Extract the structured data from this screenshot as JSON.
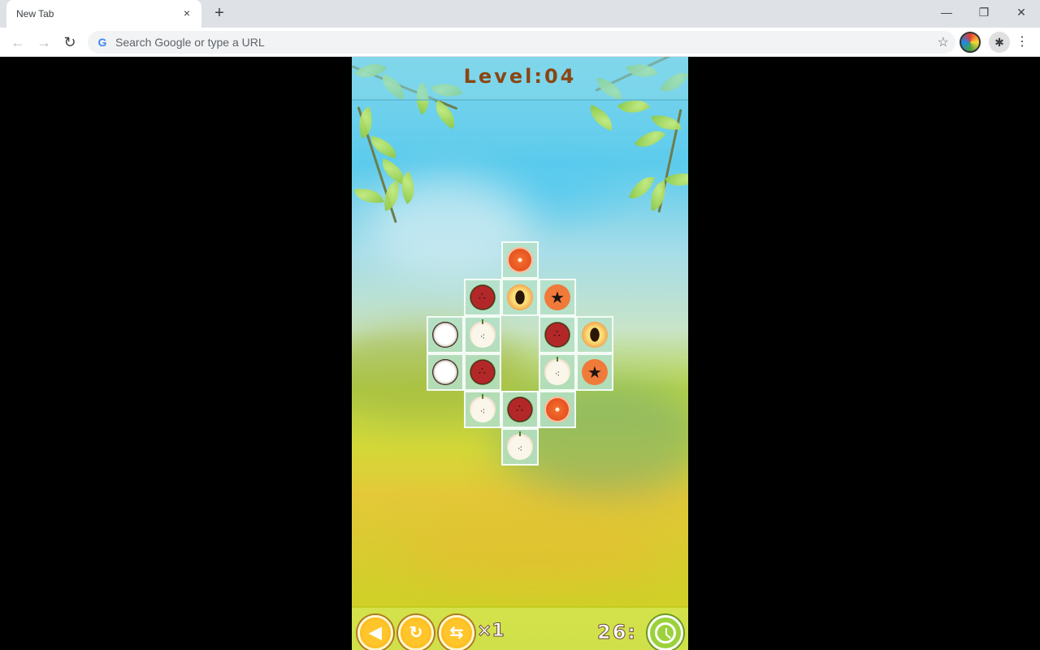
{
  "browser": {
    "tab_title": "New Tab",
    "tab_close_icon": "×",
    "new_tab_icon": "+",
    "window_controls": {
      "minimize": "—",
      "restore": "❐",
      "close": "✕"
    },
    "nav": {
      "back": "←",
      "forward": "→",
      "reload": "↻"
    },
    "omnibox": {
      "google_icon": "G",
      "placeholder": "Search Google or type a URL",
      "value": ""
    },
    "bookmark_icon": "☆",
    "extensions_icon": "✱",
    "menu_icon": "⋮"
  },
  "game": {
    "level_label": "Level:04",
    "board": {
      "columns": 5,
      "rows": 6,
      "tiles": [
        {
          "row": 0,
          "col": 2,
          "fruit": "orange"
        },
        {
          "row": 1,
          "col": 1,
          "fruit": "watermelon"
        },
        {
          "row": 1,
          "col": 2,
          "fruit": "peach"
        },
        {
          "row": 1,
          "col": 3,
          "fruit": "papaya"
        },
        {
          "row": 2,
          "col": 0,
          "fruit": "coconut"
        },
        {
          "row": 2,
          "col": 1,
          "fruit": "apple"
        },
        {
          "row": 2,
          "col": 3,
          "fruit": "watermelon"
        },
        {
          "row": 2,
          "col": 4,
          "fruit": "peach"
        },
        {
          "row": 3,
          "col": 0,
          "fruit": "coconut"
        },
        {
          "row": 3,
          "col": 1,
          "fruit": "watermelon"
        },
        {
          "row": 3,
          "col": 3,
          "fruit": "apple"
        },
        {
          "row": 3,
          "col": 4,
          "fruit": "papaya"
        },
        {
          "row": 4,
          "col": 1,
          "fruit": "apple"
        },
        {
          "row": 4,
          "col": 2,
          "fruit": "watermelon"
        },
        {
          "row": 4,
          "col": 3,
          "fruit": "orange"
        },
        {
          "row": 5,
          "col": 2,
          "fruit": "apple"
        }
      ]
    },
    "controls": {
      "back_icon": "◀",
      "restart_icon": "↻",
      "shuffle_icon": "⇆",
      "shuffle_count": "×1",
      "timer": "26:",
      "clock_icon": "clock-icon"
    }
  }
}
